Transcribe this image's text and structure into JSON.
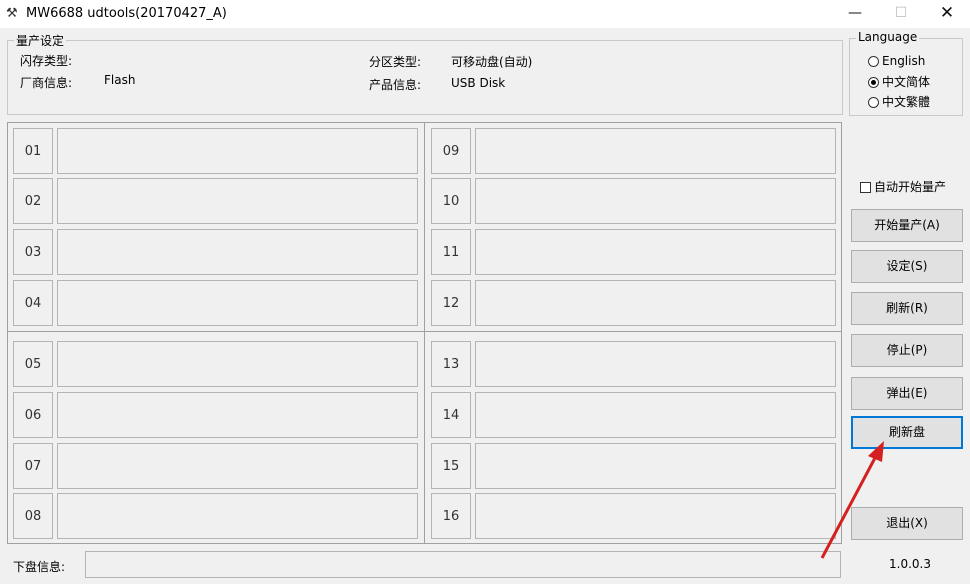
{
  "window": {
    "title": "MW6688 udtools(20170427_A)",
    "min_glyph": "—",
    "max_glyph": "☐",
    "close_glyph": "✕"
  },
  "mass_production": {
    "legend": "量产设定",
    "flash_type_label": "闪存类型:",
    "flash_type_value": "",
    "vendor_label": "厂商信息:",
    "vendor_value": "Flash",
    "partition_label": "分区类型:",
    "partition_value": "可移动盘(自动)",
    "product_label": "产品信息:",
    "product_value": "USB Disk"
  },
  "language": {
    "legend": "Language",
    "options": [
      {
        "label": "English",
        "checked": false
      },
      {
        "label": "中文简体",
        "checked": true
      },
      {
        "label": "中文繁體",
        "checked": false
      }
    ]
  },
  "ports": [
    "01",
    "02",
    "03",
    "04",
    "05",
    "06",
    "07",
    "08",
    "09",
    "10",
    "11",
    "12",
    "13",
    "14",
    "15",
    "16"
  ],
  "auto_start": {
    "label": "自动开始量产",
    "checked": false
  },
  "buttons": {
    "start": "开始量产(A)",
    "settings": "设定(S)",
    "refresh": "刷新(R)",
    "stop": "停止(P)",
    "eject": "弹出(E)",
    "refresh_disk": "刷新盘",
    "exit": "退出(X)"
  },
  "status": {
    "label": "下盘信息:",
    "value": ""
  },
  "version": "1.0.0.3",
  "accent_color": "#0078d7",
  "arrow_color": "#d42020"
}
